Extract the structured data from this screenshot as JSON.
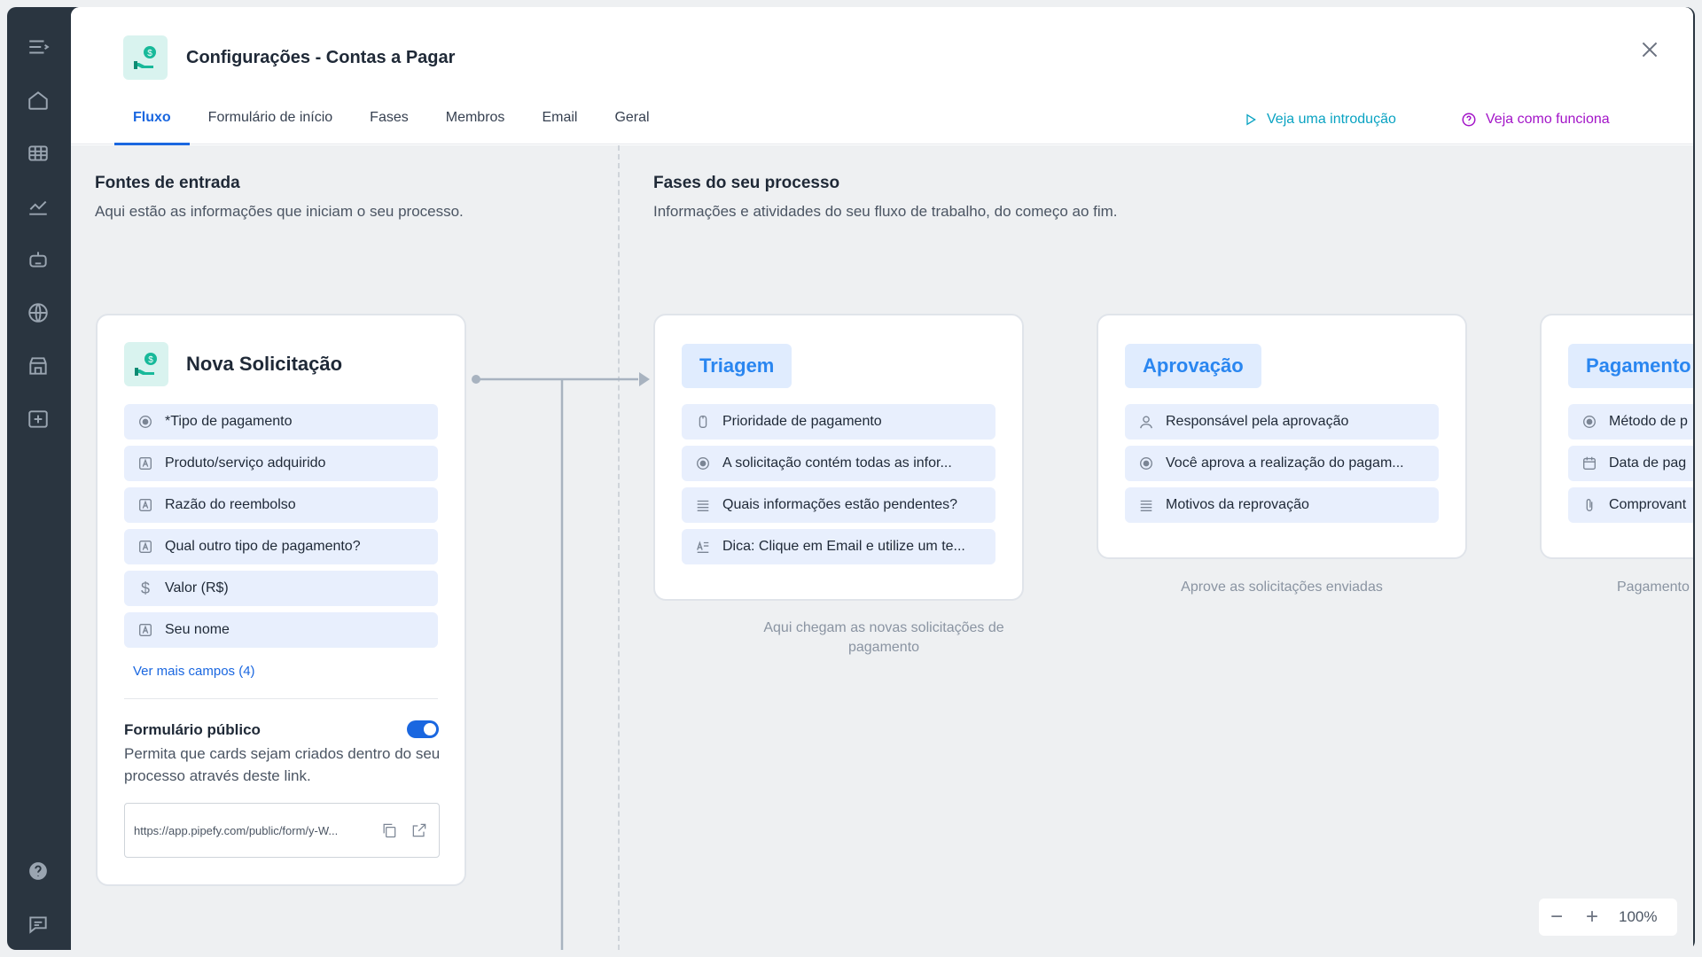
{
  "header": {
    "title": "Configurações - Contas a Pagar",
    "tabs": [
      "Fluxo",
      "Formulário de início",
      "Fases",
      "Membros",
      "Email",
      "Geral"
    ],
    "intro_link": "Veja uma introdução",
    "how_link": "Veja como funciona"
  },
  "sources": {
    "title": "Fontes de entrada",
    "subtitle": "Aqui estão as informações que iniciam o seu processo."
  },
  "phases_section": {
    "title": "Fases do seu processo",
    "subtitle": "Informações e atividades do seu fluxo de trabalho, do começo ao fim."
  },
  "start_form": {
    "title": "Nova Solicitação",
    "fields": [
      "*Tipo de pagamento",
      "Produto/serviço adquirido",
      "Razão do reembolso",
      "Qual outro tipo de pagamento?",
      "Valor (R$)",
      "Seu nome"
    ],
    "see_more": "Ver mais campos (4)",
    "public_form_title": "Formulário público",
    "public_form_desc": "Permita que cards sejam criados dentro do seu processo através deste link.",
    "public_form_enabled": true,
    "public_url": "https://app.pipefy.com/public/form/y-W..."
  },
  "phases": [
    {
      "name": "Triagem",
      "fields": [
        "Prioridade de pagamento",
        "A solicitação contém todas as infor...",
        "Quais informações estão pendentes?",
        "Dica: Clique em Email e utilize um te..."
      ],
      "caption": "Aqui chegam as novas solicitações de pagamento"
    },
    {
      "name": "Aprovação",
      "fields": [
        "Responsável pela aprovação",
        "Você aprova a realização do pagam...",
        "Motivos da reprovação"
      ],
      "caption": "Aprove as solicitações enviadas"
    },
    {
      "name": "Pagamento",
      "fields": [
        "Método de p",
        "Data de pag",
        "Comprovant"
      ],
      "caption": "Pagamento"
    }
  ],
  "zoom": {
    "minus": "−",
    "plus": "+",
    "level": "100%"
  },
  "colors": {
    "accent": "#1a67e0",
    "phase": "#2a86f0",
    "intro": "#0aa3c2",
    "how": "#a315c8",
    "rail": "#2a3540"
  }
}
